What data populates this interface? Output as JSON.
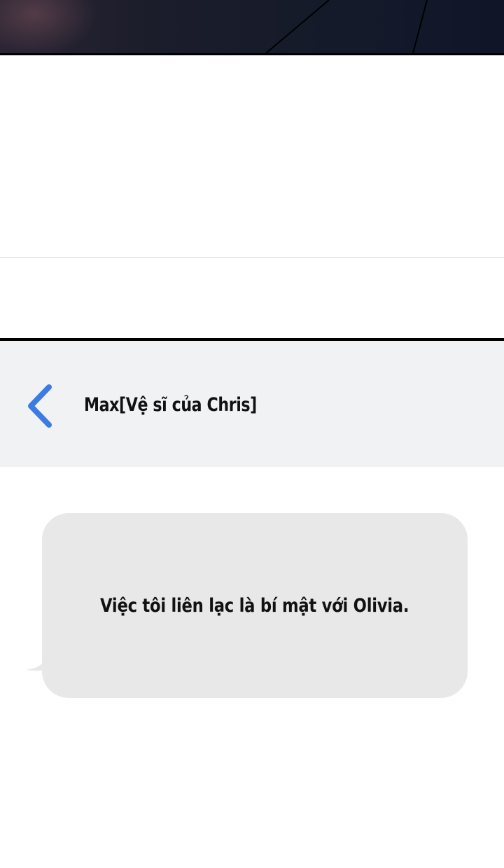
{
  "chat": {
    "contact_name": "Max[Vệ sĩ của Chris]",
    "back_icon": "chevron-left-icon",
    "accent_color": "#3b7be2",
    "header_bg": "#f1f2f4",
    "bubble_bg": "#e8e8e9"
  },
  "messages": [
    {
      "text": "Việc tôi liên lạc là bí mật với Olivia."
    }
  ]
}
